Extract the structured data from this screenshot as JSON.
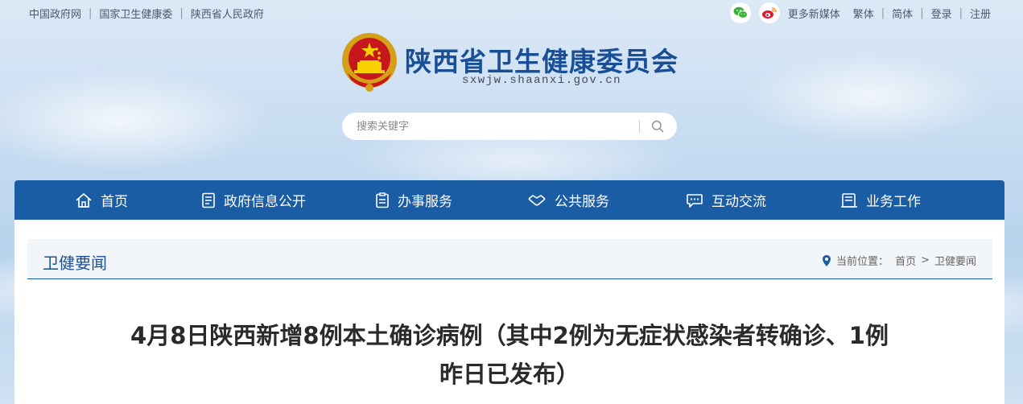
{
  "header": {
    "top_links": [
      "中国政府网",
      "国家卫生健康委",
      "陕西省人民政府"
    ],
    "media_label": "更多新媒体",
    "top_right_links": [
      "繁体",
      "简体",
      "登录",
      "注册"
    ],
    "site_title": "陕西省卫生健康委员会",
    "site_url": "sxwjw.shaanxi.gov.cn",
    "search_placeholder": "搜索关键字"
  },
  "nav": {
    "items": [
      {
        "label": "首页",
        "icon": "home-icon"
      },
      {
        "label": "政府信息公开",
        "icon": "document-icon"
      },
      {
        "label": "办事服务",
        "icon": "clipboard-icon"
      },
      {
        "label": "公共服务",
        "icon": "handshake-icon"
      },
      {
        "label": "互动交流",
        "icon": "chat-icon"
      },
      {
        "label": "业务工作",
        "icon": "folder-icon"
      }
    ]
  },
  "section": {
    "title": "卫健要闻",
    "breadcrumb_prefix": "当前位置：",
    "breadcrumb": [
      "首页",
      "卫健要闻"
    ]
  },
  "article": {
    "title_line1": "4月8日陕西新增8例本土确诊病例（其中2例为无症状感染者转确诊、1例",
    "title_line2": "昨日已发布）"
  },
  "colors": {
    "brand_blue": "#1b5da5",
    "title_blue": "#1b4f95",
    "wechat_green": "#3cb034",
    "weibo_red": "#e6162d"
  }
}
